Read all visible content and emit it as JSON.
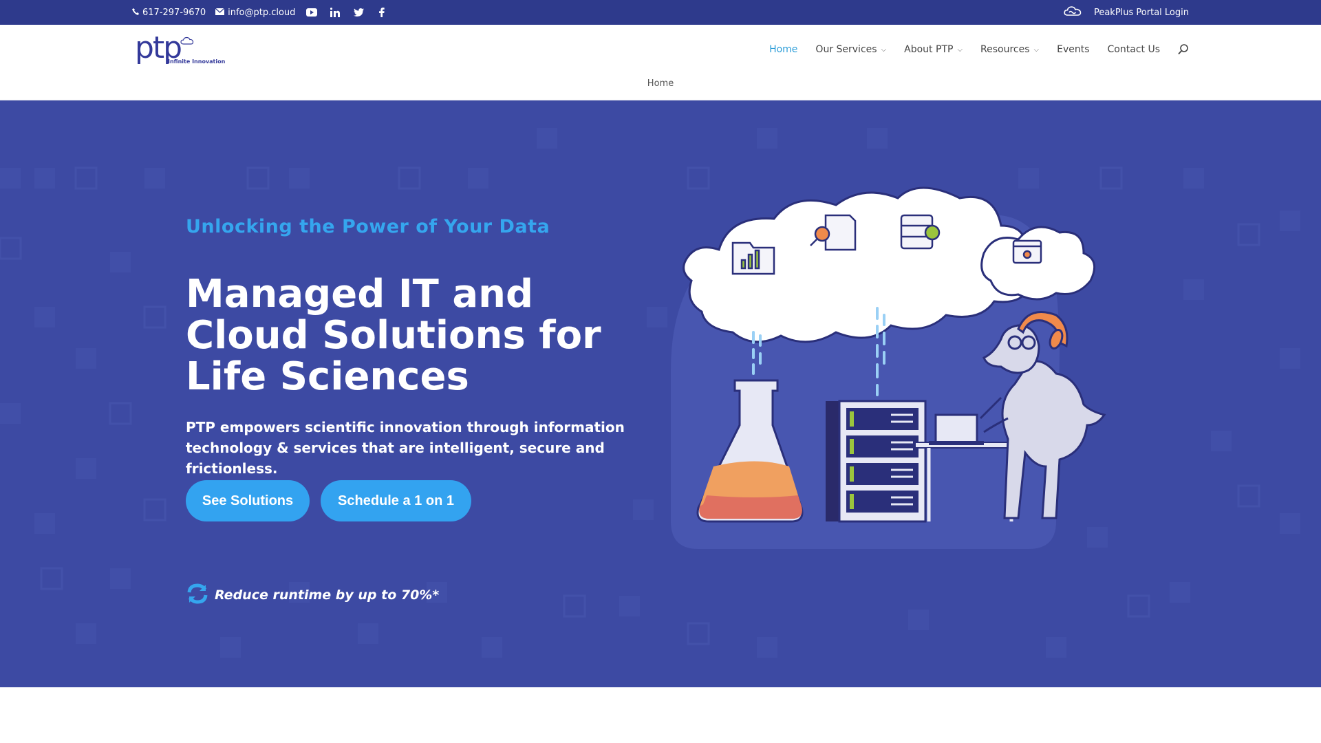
{
  "topbar": {
    "phone": "617-297-9670",
    "email": "info@ptp.cloud",
    "social_icons": [
      "youtube-icon",
      "linkedin-icon",
      "twitter-icon",
      "facebook-icon"
    ],
    "portal_label": "PeakPlus Portal Login"
  },
  "header": {
    "logo_text": "ptp",
    "logo_tagline": "Infinite Innovation",
    "nav": [
      {
        "label": "Home",
        "active": true,
        "dropdown": false
      },
      {
        "label": "Our Services",
        "active": false,
        "dropdown": true
      },
      {
        "label": "About PTP",
        "active": false,
        "dropdown": true
      },
      {
        "label": "Resources",
        "active": false,
        "dropdown": true
      },
      {
        "label": "Events",
        "active": false,
        "dropdown": false
      },
      {
        "label": "Contact Us",
        "active": false,
        "dropdown": false
      }
    ],
    "breadcrumb": "Home"
  },
  "hero": {
    "eyebrow": "Unlocking the Power of Your Data",
    "headline": "Managed IT and Cloud Solutions for Life Sciences",
    "lede": "PTP empowers scientific innovation through information technology & services that are intelligent, secure and frictionless.",
    "primary_cta": "See Solutions",
    "secondary_cta": "Schedule a 1 on 1",
    "stat_text": "Reduce runtime by up to 70%*"
  },
  "colors": {
    "topbar": "#2e3a8c",
    "hero_bg": "#3d4aa3",
    "accent_blue": "#33a3f0",
    "nav_active": "#2e9ed8",
    "flask_fill": "#f0a060"
  }
}
